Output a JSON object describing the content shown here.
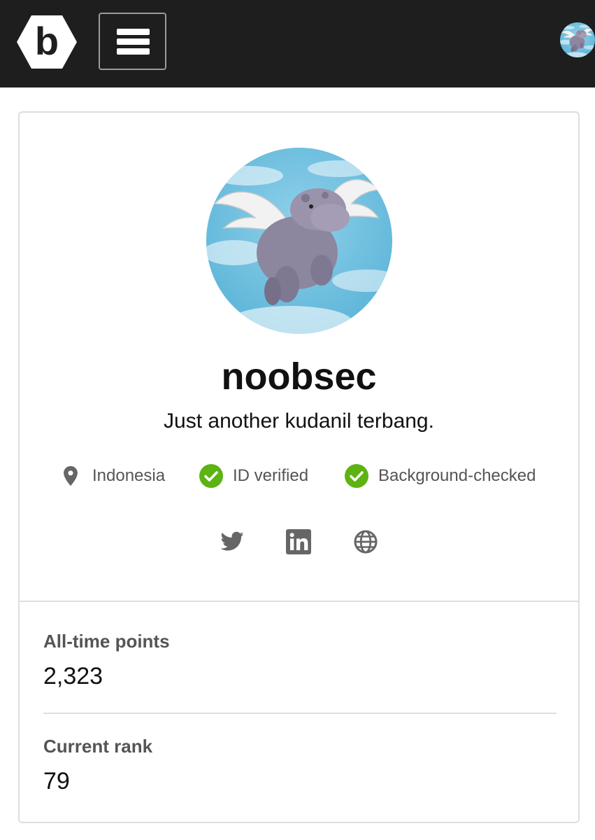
{
  "header": {
    "logo_icon": "bugcrowd-b-hexagon-icon",
    "menu_icon": "hamburger-menu-icon",
    "avatar_icon": "flying-hippo-avatar"
  },
  "profile": {
    "username": "noobsec",
    "bio": "Just another kudanil terbang.",
    "badges": [
      {
        "icon": "location-pin-icon",
        "label": "Indonesia"
      },
      {
        "icon": "check-circle-icon",
        "label": "ID verified"
      },
      {
        "icon": "check-circle-icon",
        "label": "Background-checked"
      }
    ],
    "social_links": [
      "twitter-icon",
      "linkedin-icon",
      "globe-icon"
    ]
  },
  "stats": [
    {
      "label": "All-time points",
      "value": "2,323"
    },
    {
      "label": "Current rank",
      "value": "79"
    }
  ],
  "colors": {
    "topbar": "#1e1e1e",
    "verified_green": "#5cb312",
    "muted_text": "#555555",
    "border": "#dedede"
  }
}
